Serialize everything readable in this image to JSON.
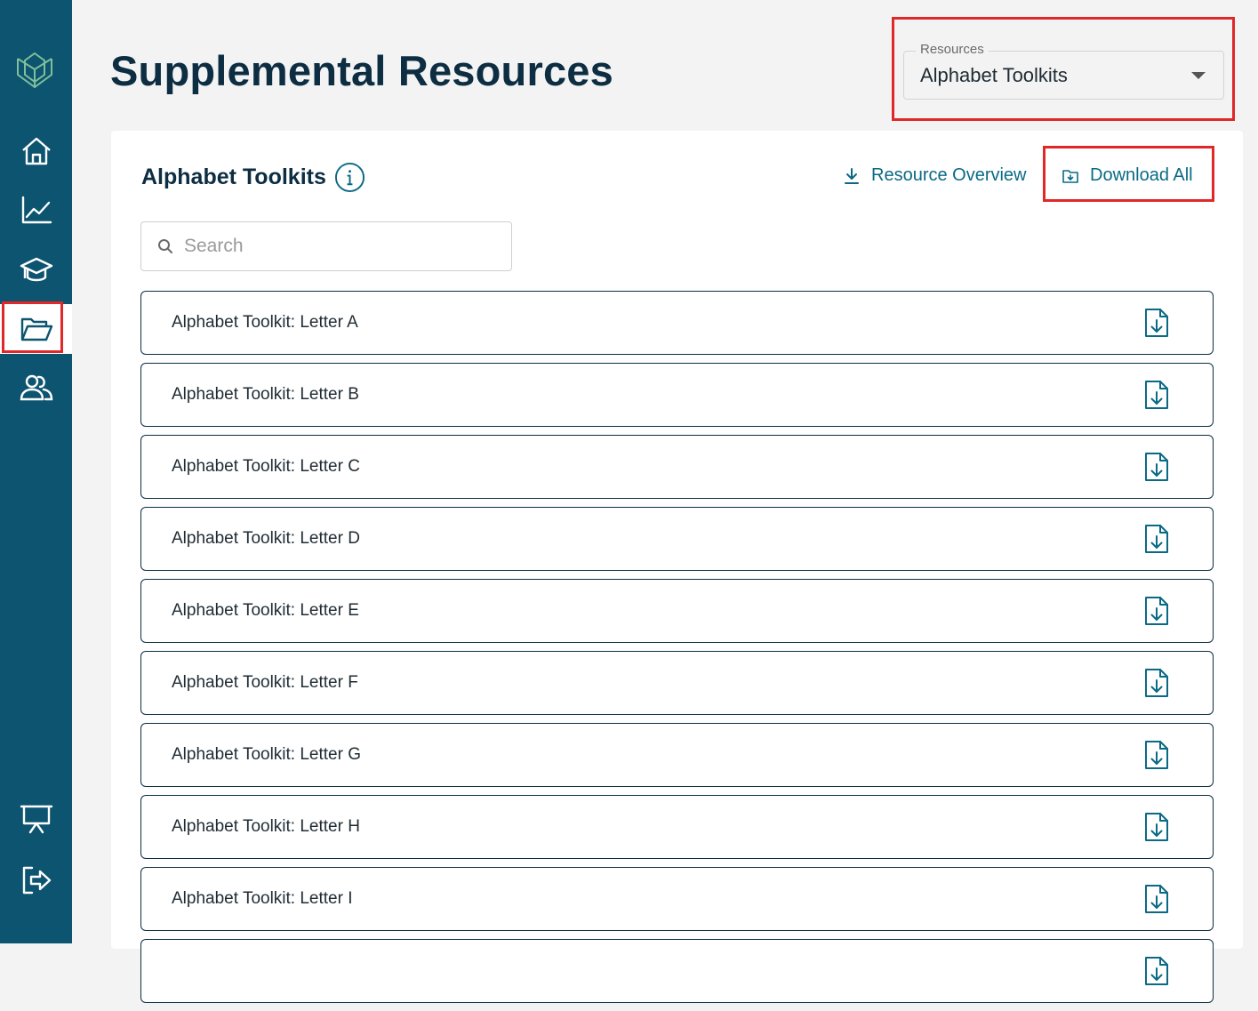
{
  "header": {
    "title": "Supplemental Resources"
  },
  "resource_select": {
    "label": "Resources",
    "value": "Alphabet Toolkits"
  },
  "card": {
    "title": "Alphabet Toolkits",
    "resource_overview_label": "Resource Overview",
    "download_all_label": "Download All"
  },
  "search": {
    "placeholder": "Search",
    "value": ""
  },
  "resources": [
    {
      "label": "Alphabet Toolkit: Letter A"
    },
    {
      "label": "Alphabet Toolkit: Letter B"
    },
    {
      "label": "Alphabet Toolkit: Letter C"
    },
    {
      "label": "Alphabet Toolkit: Letter D"
    },
    {
      "label": "Alphabet Toolkit: Letter E"
    },
    {
      "label": "Alphabet Toolkit: Letter F"
    },
    {
      "label": "Alphabet Toolkit: Letter G"
    },
    {
      "label": "Alphabet Toolkit: Letter H"
    },
    {
      "label": "Alphabet Toolkit: Letter I"
    },
    {
      "label": ""
    }
  ],
  "sidebar": {
    "items": [
      {
        "icon": "home-icon"
      },
      {
        "icon": "chart-line-icon"
      },
      {
        "icon": "graduation-cap-icon"
      },
      {
        "icon": "folder-open-icon",
        "active": true
      },
      {
        "icon": "users-icon"
      },
      {
        "icon": "presentation-icon"
      },
      {
        "icon": "logout-icon"
      }
    ]
  },
  "colors": {
    "sidebar": "#0c5470",
    "accent": "#0a6a86",
    "title": "#0d2e42",
    "highlight": "#e12828"
  }
}
